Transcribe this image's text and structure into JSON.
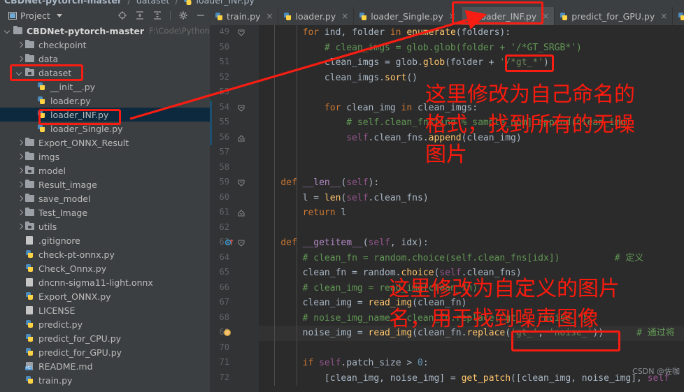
{
  "breadcrumb": {
    "project": "CBDNet-pytorch-master",
    "folder": "dataset",
    "file": "loader_INF.py",
    "sep": "/"
  },
  "project_panel": {
    "title": "Project",
    "caret_icon": "chevron-down-icon",
    "toolbar_icons": [
      "locate-target-icon",
      "expand-all-icon",
      "collapse-all-icon",
      "gear-icon",
      "hide-icon",
      "more-icon"
    ],
    "tree": [
      {
        "indent": 0,
        "arrow": "down",
        "icon": "folder-icon",
        "label": "CBDNet-pytorch-master",
        "bold": true,
        "path": "F:\\Code\\Python\\CB",
        "selected": false
      },
      {
        "indent": 1,
        "arrow": "right",
        "icon": "folder-icon",
        "label": "checkpoint",
        "bold": false,
        "path": "",
        "selected": false
      },
      {
        "indent": 1,
        "arrow": "right",
        "icon": "folder-icon",
        "label": "data",
        "bold": false,
        "path": "",
        "selected": false
      },
      {
        "indent": 1,
        "arrow": "down",
        "icon": "folder-source-icon",
        "label": "dataset",
        "bold": false,
        "path": "",
        "selected": false
      },
      {
        "indent": 2,
        "arrow": "none",
        "icon": "python-file-icon",
        "label": "__init__.py",
        "bold": false,
        "path": "",
        "selected": false
      },
      {
        "indent": 2,
        "arrow": "none",
        "icon": "python-file-icon",
        "label": "loader.py",
        "bold": false,
        "path": "",
        "selected": false
      },
      {
        "indent": 2,
        "arrow": "none",
        "icon": "python-file-icon",
        "label": "loader_INF.py",
        "bold": false,
        "path": "",
        "selected": true
      },
      {
        "indent": 2,
        "arrow": "none",
        "icon": "python-file-icon",
        "label": "loader_Single.py",
        "bold": false,
        "path": "",
        "selected": false
      },
      {
        "indent": 1,
        "arrow": "right",
        "icon": "folder-icon",
        "label": "Export_ONNX_Result",
        "bold": false,
        "path": "",
        "selected": false
      },
      {
        "indent": 1,
        "arrow": "right",
        "icon": "folder-icon",
        "label": "imgs",
        "bold": false,
        "path": "",
        "selected": false
      },
      {
        "indent": 1,
        "arrow": "right",
        "icon": "folder-source-icon",
        "label": "model",
        "bold": false,
        "path": "",
        "selected": false
      },
      {
        "indent": 1,
        "arrow": "right",
        "icon": "folder-icon",
        "label": "Result_image",
        "bold": false,
        "path": "",
        "selected": false
      },
      {
        "indent": 1,
        "arrow": "right",
        "icon": "folder-icon",
        "label": "save_model",
        "bold": false,
        "path": "",
        "selected": false
      },
      {
        "indent": 1,
        "arrow": "right",
        "icon": "folder-icon",
        "label": "Test_Image",
        "bold": false,
        "path": "",
        "selected": false
      },
      {
        "indent": 1,
        "arrow": "right",
        "icon": "folder-source-icon",
        "label": "utils",
        "bold": false,
        "path": "",
        "selected": false
      },
      {
        "indent": 1,
        "arrow": "none",
        "icon": "gitignore-file-icon",
        "label": ".gitignore",
        "bold": false,
        "path": "",
        "selected": false
      },
      {
        "indent": 1,
        "arrow": "none",
        "icon": "python-file-icon",
        "label": "check-pt-onnx.py",
        "bold": false,
        "path": "",
        "selected": false
      },
      {
        "indent": 1,
        "arrow": "none",
        "icon": "python-file-icon",
        "label": "Check_Onnx.py",
        "bold": false,
        "path": "",
        "selected": false
      },
      {
        "indent": 1,
        "arrow": "none",
        "icon": "onnx-file-icon",
        "label": "dncnn-sigma11-light.onnx",
        "bold": false,
        "path": "",
        "selected": false
      },
      {
        "indent": 1,
        "arrow": "none",
        "icon": "python-file-icon",
        "label": "Export_ONNX.py",
        "bold": false,
        "path": "",
        "selected": false
      },
      {
        "indent": 1,
        "arrow": "none",
        "icon": "text-file-icon",
        "label": "LICENSE",
        "bold": false,
        "path": "",
        "selected": false
      },
      {
        "indent": 1,
        "arrow": "none",
        "icon": "python-file-icon",
        "label": "predict.py",
        "bold": false,
        "path": "",
        "selected": false
      },
      {
        "indent": 1,
        "arrow": "none",
        "icon": "python-file-icon",
        "label": "predict_for_CPU.py",
        "bold": false,
        "path": "",
        "selected": false
      },
      {
        "indent": 1,
        "arrow": "none",
        "icon": "python-file-icon",
        "label": "predict_for_GPU.py",
        "bold": false,
        "path": "",
        "selected": false
      },
      {
        "indent": 1,
        "arrow": "none",
        "icon": "markdown-file-icon",
        "label": "README.md",
        "bold": false,
        "path": "",
        "selected": false
      },
      {
        "indent": 1,
        "arrow": "none",
        "icon": "python-file-icon",
        "label": "train.py",
        "bold": false,
        "path": "",
        "selected": false
      }
    ]
  },
  "editor": {
    "tabs": [
      {
        "label": "train.py",
        "active": false,
        "icon": "python-file-icon",
        "close": "×"
      },
      {
        "label": "loader.py",
        "active": false,
        "icon": "python-file-icon",
        "close": "×"
      },
      {
        "label": "loader_Single.py",
        "active": false,
        "icon": "python-file-icon",
        "close": "×"
      },
      {
        "label": "loader_INF.py",
        "active": true,
        "icon": "python-file-icon",
        "close": "×"
      },
      {
        "label": "predict_for_GPU.py",
        "active": false,
        "icon": "python-file-icon",
        "close": "×"
      },
      {
        "label": "pr",
        "active": false,
        "icon": "python-file-icon",
        "close": ""
      }
    ],
    "first_line_number": 49,
    "lines": [
      {
        "n": 49,
        "fold": "minus",
        "text": "        for ind, folder in enumerate(folders):"
      },
      {
        "n": 50,
        "fold": "",
        "text": "            # clean_imgs = glob.glob(folder + '/*GT_SRGB*')"
      },
      {
        "n": 51,
        "fold": "",
        "text": "            clean_imgs = glob.glob(folder + '/*gt_*')"
      },
      {
        "n": 52,
        "fold": "",
        "text": "            clean_imgs.sort()"
      },
      {
        "n": 53,
        "fold": "",
        "text": ""
      },
      {
        "n": 54,
        "fold": "minus",
        "text": "            for clean_img in clean_imgs:"
      },
      {
        "n": 55,
        "fold": "",
        "text": "                # self.clean_fns[ind % sample_num].append(clean_img)"
      },
      {
        "n": 56,
        "fold": "end",
        "text": "                self.clean_fns.append(clean_img)"
      },
      {
        "n": 57,
        "fold": "",
        "text": ""
      },
      {
        "n": 58,
        "fold": "",
        "text": ""
      },
      {
        "n": 59,
        "fold": "minus",
        "text": "    def __len__(self):"
      },
      {
        "n": 60,
        "fold": "",
        "text": "        l = len(self.clean_fns)"
      },
      {
        "n": 61,
        "fold": "end",
        "text": "        return l"
      },
      {
        "n": 62,
        "fold": "",
        "text": ""
      },
      {
        "n": 63,
        "fold": "minus",
        "text": "    def __getitem__(self, idx):"
      },
      {
        "n": 64,
        "fold": "",
        "text": "        # clean_fn = random.choice(self.clean_fns[idx])          # 定义"
      },
      {
        "n": 65,
        "fold": "",
        "text": "        clean_fn = random.choice(self.clean_fns)"
      },
      {
        "n": 66,
        "fold": "",
        "text": "        # clean_img = read_img(clean_fn)"
      },
      {
        "n": 67,
        "fold": "",
        "text": "        clean_img = read_img(clean_fn)"
      },
      {
        "n": 68,
        "fold": "",
        "text": "        # noise_img_name = clean_fn.replace('gt_', 'noise_')"
      },
      {
        "n": 69,
        "fold": "",
        "text": "        noise_img = read_img(clean_fn.replace('gt_', 'noise_'))      # 通过将"
      },
      {
        "n": 70,
        "fold": "",
        "text": ""
      },
      {
        "n": 71,
        "fold": "",
        "text": "        if self.patch_size > 0:"
      },
      {
        "n": 72,
        "fold": "",
        "text": "            [clean_img, noise_img] = get_patch([clean_img, noise_img], self"
      }
    ]
  },
  "annotations": {
    "color": "#fb1a0d",
    "note_1": "这里修改为自己命名的\n格式，找到所有的无噪\n图片",
    "note_2": "这里修改为自定义的图片\n名，用于找到噪声图像",
    "highlight_boxes": [
      {
        "name": "dataset-folder-box"
      },
      {
        "name": "loader-inf-tree-box"
      },
      {
        "name": "loader-inf-tab-box"
      },
      {
        "name": "gt-glob-pattern-box"
      },
      {
        "name": "replace-args-box"
      }
    ],
    "arrow": "tree-to-tab-arrow"
  },
  "watermark": "CSDN @佐咖"
}
